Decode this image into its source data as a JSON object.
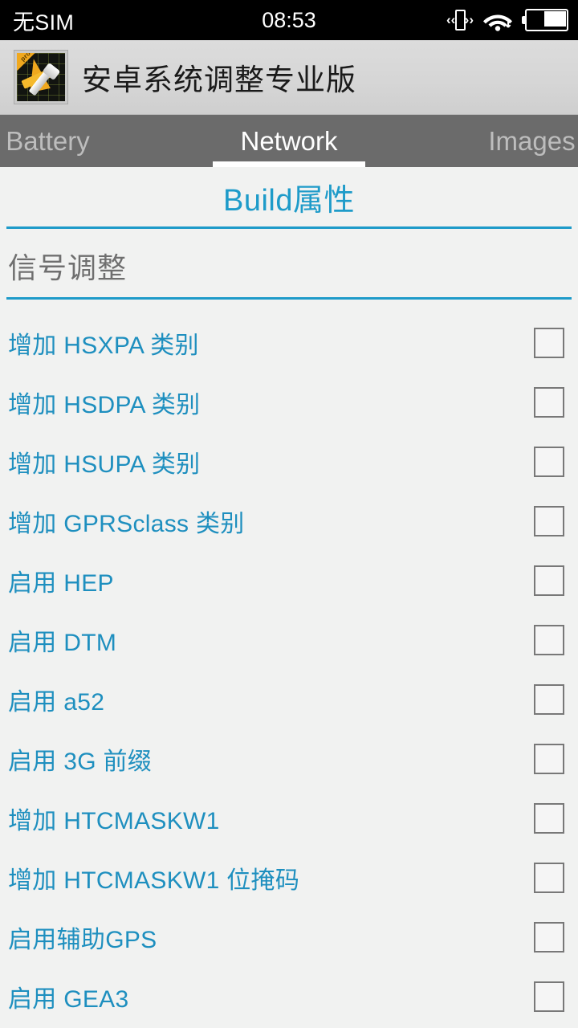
{
  "status_bar": {
    "carrier": "无SIM",
    "clock": "08:53",
    "icons": [
      "vibrate-icon",
      "wifi-icon",
      "battery-icon"
    ],
    "battery_level_pct": 50
  },
  "app_bar": {
    "title": "安卓系统调整专业版",
    "icon": "app-logo-icon",
    "badge": "pro"
  },
  "tabs": [
    {
      "label": "Battery",
      "active": false
    },
    {
      "label": "Network",
      "active": true
    },
    {
      "label": "Images",
      "active": false
    }
  ],
  "page": {
    "title": "Build属性"
  },
  "section": {
    "title": "信号调整"
  },
  "list": [
    {
      "label": "增加 HSXPA 类别",
      "checked": false
    },
    {
      "label": "增加 HSDPA 类别",
      "checked": false
    },
    {
      "label": "增加 HSUPA 类别",
      "checked": false
    },
    {
      "label": "增加 GPRSclass 类别",
      "checked": false
    },
    {
      "label": "启用 HEP",
      "checked": false
    },
    {
      "label": "启用 DTM",
      "checked": false
    },
    {
      "label": "启用 a52",
      "checked": false
    },
    {
      "label": "启用 3G 前缀",
      "checked": false
    },
    {
      "label": "增加 HTCMASKW1",
      "checked": false
    },
    {
      "label": "增加 HTCMASKW1 位掩码",
      "checked": false
    },
    {
      "label": "启用辅助GPS",
      "checked": false
    },
    {
      "label": "启用 GEA3",
      "checked": false
    }
  ],
  "colors": {
    "accent_blue": "#1e9bc9",
    "list_text": "#1e8fbf",
    "tab_bar": "#6b6b6b",
    "app_bar": "#d6d6d6",
    "page_bg": "#f1f2f1",
    "section_text": "#6f6f6f",
    "status_bar": "#000000"
  }
}
